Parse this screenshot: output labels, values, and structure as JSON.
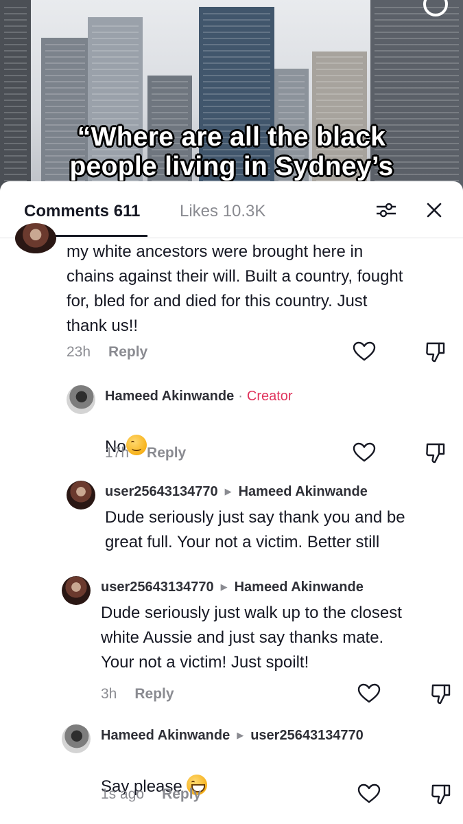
{
  "video": {
    "caption_line1": "“Where are all the black",
    "caption_line2": "people living in Sydney’s"
  },
  "sheet": {
    "tab_comments": "Comments 611",
    "tab_likes": "Likes 10.3K"
  },
  "comments": [
    {
      "text": "my white ancestors were brought here in\nchains against their will. Built a country, fought\nfor, bled for and died for this country. Just\nthank us!!",
      "time": "23h",
      "reply_label": "Reply"
    },
    {
      "author": "Hameed Akinwande",
      "badge": "Creator",
      "text": "No",
      "time": "17h",
      "reply_label": "Reply"
    },
    {
      "author": "user25643134770",
      "reply_to": "Hameed Akinwande",
      "text": "Dude seriously just say thank you and be\ngreat full. Your not a victim. Better still"
    },
    {
      "author": "user25643134770",
      "reply_to": "Hameed Akinwande",
      "text": "Dude seriously just walk up to the closest\nwhite Aussie and just say thanks mate.\nYour not a victim! Just spoilt!",
      "time": "3h",
      "reply_label": "Reply"
    },
    {
      "author": "Hameed Akinwande",
      "reply_to": "user25643134770",
      "text": "Say please",
      "time": "1s ago",
      "reply_label": "Reply"
    }
  ],
  "icons": {
    "like": "heart-icon",
    "dislike": "thumbs-down-icon",
    "filter": "sliders-icon",
    "close": "close-icon"
  },
  "colors": {
    "creator_badge": "#e0335c",
    "secondary_text": "#8a8b91",
    "primary_text": "#161823"
  }
}
